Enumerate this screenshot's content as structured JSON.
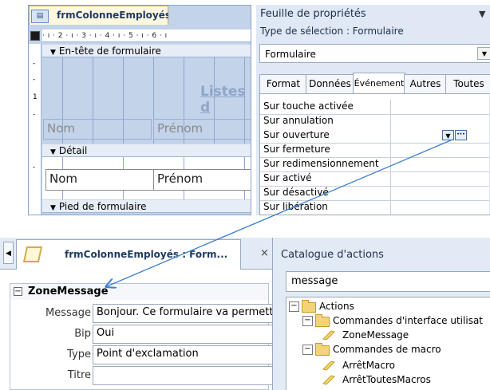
{
  "form_designer": {
    "tab_title": "frmColonneEmployés",
    "ruler": "· ı · 2 · ı · 3 · ı · 4 · ı · 5 · ı · 6 · ı",
    "vertical_ruler": [
      "-",
      "-",
      "1",
      "-",
      "-"
    ],
    "sections": {
      "header": "En-tête de formulaire",
      "detail": "Détail",
      "footer": "Pied de formulaire"
    },
    "header_title": "Listes d",
    "header_labels": [
      "Nom",
      "Prénom"
    ],
    "detail_fields": [
      "Nom",
      "Prénom"
    ]
  },
  "property_sheet": {
    "title": "Feuille de propriétés",
    "selection_type": "Type de sélection :  Formulaire",
    "selected_object": "Formulaire",
    "tabs": [
      {
        "label": "Format"
      },
      {
        "label": "Données"
      },
      {
        "label": "Événement",
        "active": true
      },
      {
        "label": "Autres"
      },
      {
        "label": "Toutes"
      }
    ],
    "rows": [
      {
        "label": "Sur touche activée"
      },
      {
        "label": "Sur annulation"
      },
      {
        "label": "Sur ouverture",
        "selected": true
      },
      {
        "label": "Sur fermeture"
      },
      {
        "label": "Sur redimensionnement"
      },
      {
        "label": "Sur activé"
      },
      {
        "label": "Sur désactivé"
      },
      {
        "label": "Sur libération"
      }
    ],
    "builder_button": "···"
  },
  "macro_editor": {
    "tab_title": "frmColonneEmployés : Form...",
    "close": "×",
    "action_name": "ZoneMessage",
    "fields": [
      {
        "label": "Message",
        "value": "Bonjour. Ce formulaire va permettr"
      },
      {
        "label": "Bip",
        "value": "Oui"
      },
      {
        "label": "Type",
        "value": "Point d'exclamation"
      },
      {
        "label": "Titre",
        "value": ""
      }
    ]
  },
  "action_catalog": {
    "title": "Catalogue d'actions",
    "search_value": "message",
    "tree": [
      {
        "label": "Actions",
        "kind": "folder",
        "expanded": true,
        "level": 0
      },
      {
        "label": "Commandes d'interface utilisat",
        "kind": "folder",
        "expanded": true,
        "level": 1
      },
      {
        "label": "ZoneMessage",
        "kind": "action",
        "level": 2
      },
      {
        "label": "Commandes de macro",
        "kind": "folder",
        "expanded": true,
        "level": 1
      },
      {
        "label": "ArrêtMacro",
        "kind": "action",
        "level": 2
      },
      {
        "label": "ArrêtToutesMacros",
        "kind": "action",
        "level": 2
      }
    ]
  },
  "colors": {
    "ribbon_blue": "#c2d3ea",
    "panel_blue": "#dfe8f4",
    "arrow": "#3b7fcf",
    "tab_gold": "#d4a94b"
  }
}
